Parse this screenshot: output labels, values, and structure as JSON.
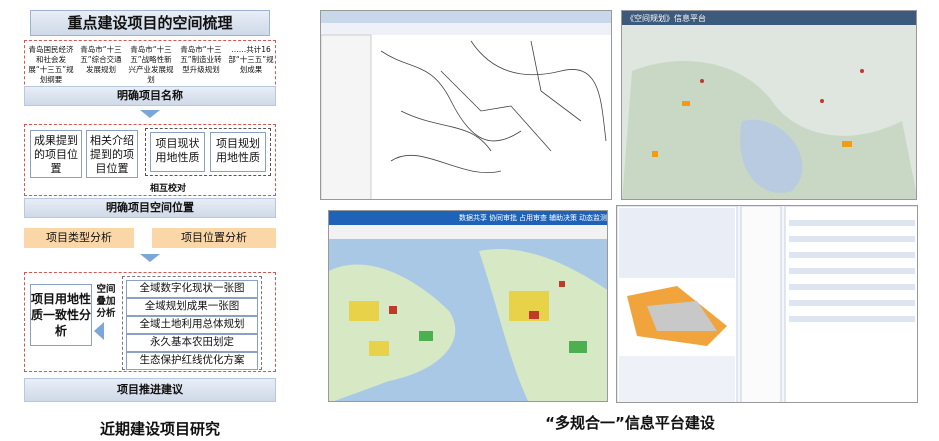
{
  "left": {
    "title": "重点建设项目的空间梳理",
    "sources": [
      "青岛国民经济和社会发展“十三五”规划纲要",
      "青岛市“十三五”综合交通发展规划",
      "青岛市“十三五”战略性新兴产业发展规划",
      "青岛市“十三五”制造业转型升级规划",
      "……共计16部“十三五”规划成果"
    ],
    "step_name": "明确项目名称",
    "box1": "成果提到的项目位置",
    "box2": "相关介绍提到的项目位置",
    "box3": "项目现状用地性质",
    "box4": "项目规划用地性质",
    "cross_check": "相互校对",
    "step_location": "明确项目空间位置",
    "type_analysis": "项目类型分析",
    "location_analysis": "项目位置分析",
    "consistency": "项目用地性质一致性分析",
    "overlay": "空间叠加分析",
    "layers": [
      "全域数字化现状一张图",
      "全域规划成果一张图",
      "全域土地利用总体规划",
      "永久基本农田划定",
      "生态保护红线优化方案"
    ],
    "promote": "项目推进建议",
    "caption": "近期建设项目研究"
  },
  "right": {
    "caption": "“多规合一”信息平台建设",
    "screen2_title": "《空间规划》信息平台",
    "screen3_menu": [
      "数据共享",
      "协同审批",
      "占用审查",
      "辅助决策",
      "动态监测"
    ]
  },
  "colors": {
    "dash": "#d9534f",
    "bar_light": "#e9eef6",
    "orange": "#fbd7a8",
    "arrow": "#7aa6d8"
  }
}
